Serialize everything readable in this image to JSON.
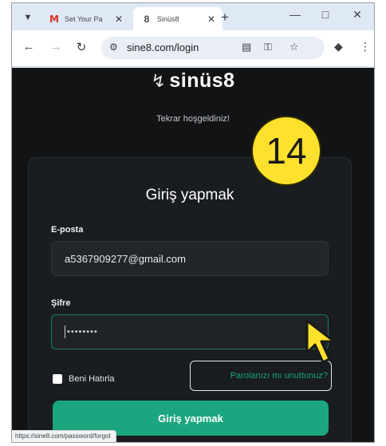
{
  "browser": {
    "tabs": [
      {
        "title": "Set Your Pa",
        "favicon": "gmail-icon",
        "active": false
      },
      {
        "title": "Sinüs8",
        "favicon": "sinus8-icon",
        "active": true
      }
    ],
    "url": "sine8.com/login",
    "status_url": "https://sine8.com/password/forgot"
  },
  "page": {
    "logo": "sinüs8",
    "welcome": "Tekrar hoşgeldiniz!",
    "form": {
      "title": "Giriş yapmak",
      "email_label": "E-posta",
      "email_value": "a5367909277@gmail.com",
      "password_label": "Şifre",
      "password_value": "••••••••",
      "remember_label": "Beni Hatırla",
      "forgot_link": "Parolanızı mı unuttunuz?",
      "submit_label": "Giriş yapmak"
    }
  },
  "overlay": {
    "step_number": "14",
    "step_color": "#fde12c"
  },
  "colors": {
    "accent": "#1ba67f",
    "page_bg": "#111315",
    "card_bg": "#191c20"
  }
}
